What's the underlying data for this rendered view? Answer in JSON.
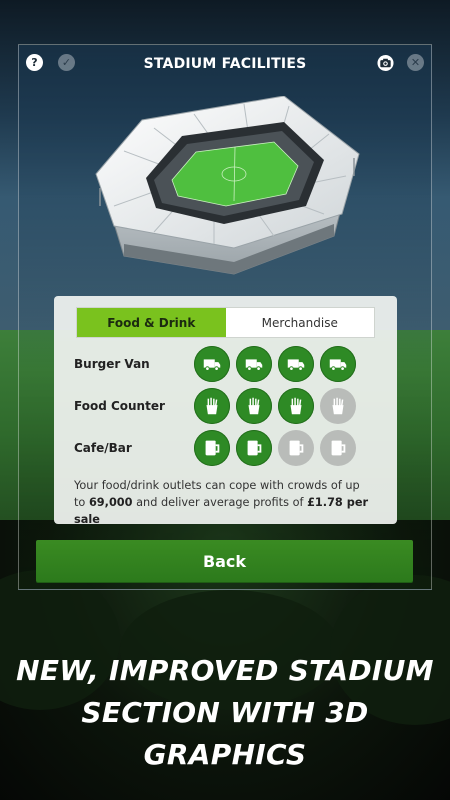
{
  "header": {
    "title": "STADIUM FACILITIES",
    "help_icon": "question-icon",
    "check_icon": "check-icon",
    "camera_icon": "camera-icon",
    "tools_icon": "wrench-icon"
  },
  "tabs": [
    {
      "label": "Food & Drink",
      "active": true
    },
    {
      "label": "Merchandise",
      "active": false
    }
  ],
  "facilities": [
    {
      "label": "Burger Van",
      "icon": "van-icon",
      "levels": [
        true,
        true,
        true,
        true
      ]
    },
    {
      "label": "Food Counter",
      "icon": "fries-icon",
      "levels": [
        true,
        true,
        true,
        false
      ]
    },
    {
      "label": "Cafe/Bar",
      "icon": "mug-icon",
      "levels": [
        true,
        true,
        false,
        false
      ]
    }
  ],
  "info": {
    "text": "Your food/drink outlets can cope with crowds of up to",
    "capacity": "69,000",
    "middle": "and deliver average profits of",
    "profit": "£1.78 per sale"
  },
  "back_label": "Back",
  "promo": {
    "line1": "NEW, IMPROVED STADIUM",
    "line2": "SECTION WITH 3D GRAPHICS"
  },
  "colors": {
    "accent_green": "#7ac21e",
    "slot_on": "#2e8a25",
    "slot_off": "#b9bcb9",
    "button": "#2c7a1c"
  }
}
